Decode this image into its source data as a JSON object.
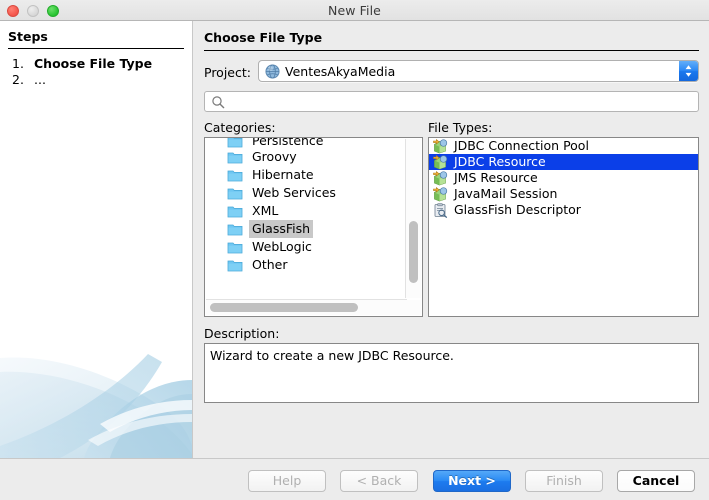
{
  "window": {
    "title": "New File",
    "traffic_lights": [
      "close-button",
      "minimize-button",
      "maximize-button"
    ]
  },
  "steps": {
    "heading": "Steps",
    "items": [
      {
        "number": "1.",
        "label": "Choose File Type",
        "active": true
      },
      {
        "number": "2.",
        "label": "...",
        "active": false
      }
    ]
  },
  "main": {
    "page_title": "Choose File Type",
    "project": {
      "label": "Project:",
      "value": "VentesAkyaMedia",
      "icon": "globe-icon"
    },
    "search": {
      "value": "",
      "placeholder": "",
      "icon": "search-icon"
    },
    "categories": {
      "label": "Categories:",
      "selected": "GlassFish",
      "items": [
        {
          "label": "Persistence",
          "icon": "folder-icon"
        },
        {
          "label": "Groovy",
          "icon": "folder-icon"
        },
        {
          "label": "Hibernate",
          "icon": "folder-icon"
        },
        {
          "label": "Web Services",
          "icon": "folder-icon"
        },
        {
          "label": "XML",
          "icon": "folder-icon"
        },
        {
          "label": "GlassFish",
          "icon": "folder-icon"
        },
        {
          "label": "WebLogic",
          "icon": "folder-icon"
        },
        {
          "label": "Other",
          "icon": "folder-icon"
        }
      ]
    },
    "file_types": {
      "label": "File Types:",
      "selected": "JDBC Resource",
      "items": [
        {
          "label": "JDBC Connection Pool",
          "icon": "resource-icon"
        },
        {
          "label": "JDBC Resource",
          "icon": "resource-icon"
        },
        {
          "label": "JMS Resource",
          "icon": "resource-icon"
        },
        {
          "label": "JavaMail Session",
          "icon": "resource-icon"
        },
        {
          "label": "GlassFish Descriptor",
          "icon": "descriptor-icon"
        }
      ]
    },
    "description": {
      "label": "Description:",
      "text": "Wizard to create a new JDBC Resource."
    }
  },
  "footer": {
    "buttons": [
      {
        "id": "help",
        "label": "Help",
        "state": "disabled"
      },
      {
        "id": "back",
        "label": "< Back",
        "state": "disabled"
      },
      {
        "id": "next",
        "label": "Next >",
        "state": "primary"
      },
      {
        "id": "finish",
        "label": "Finish",
        "state": "disabled"
      },
      {
        "id": "cancel",
        "label": "Cancel",
        "state": "enabled"
      }
    ]
  },
  "colors": {
    "selection_active": "#0b3fe8",
    "selection_inactive": "#c8c8c8",
    "primary_button": "#2b8bf4",
    "window_background": "#ececec"
  }
}
